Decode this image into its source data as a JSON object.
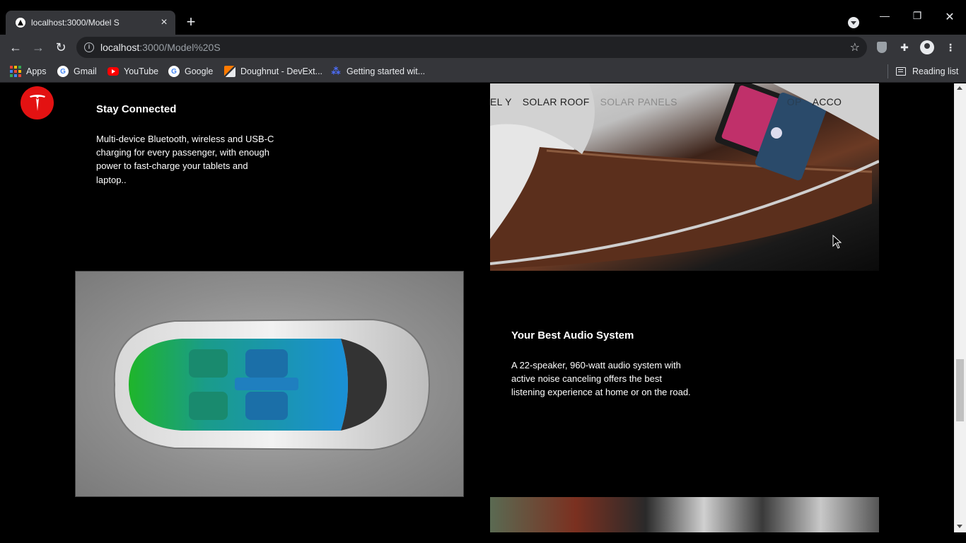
{
  "browser": {
    "tab_title": "localhost:3000/Model S",
    "new_tab": "+",
    "url_host": "localhost",
    "url_path": ":3000/Model%20S",
    "window": {
      "minimize": "—",
      "restore": "❐",
      "close": "✕"
    }
  },
  "bookmarks": [
    {
      "label": "Apps",
      "icon": "apps-grid-icon"
    },
    {
      "label": "Gmail",
      "icon": "google-icon"
    },
    {
      "label": "YouTube",
      "icon": "youtube-icon"
    },
    {
      "label": "Google",
      "icon": "google-icon"
    },
    {
      "label": "Doughnut - DevExt...",
      "icon": "devextreme-icon"
    },
    {
      "label": "Getting started wit...",
      "icon": "getting-started-icon"
    }
  ],
  "reading_list": "Reading list",
  "page": {
    "nav": [
      "EL Y",
      "SOLAR ROOF",
      "SOLAR PANELS",
      "OP",
      "ACCO"
    ],
    "feature1": {
      "title": "Stay Connected",
      "body": "Multi-device Bluetooth, wireless and USB-C charging for every passenger, with enough power to fast-charge your tablets and laptop.."
    },
    "feature2": {
      "title": "Your Best Audio System",
      "body": "A 22-speaker, 960-watt audio system with active noise canceling offers the best listening experience at home or on the road."
    }
  },
  "colors": {
    "brand_red": "#e31212",
    "chrome_bg": "#35363a",
    "page_bg": "#000000"
  }
}
